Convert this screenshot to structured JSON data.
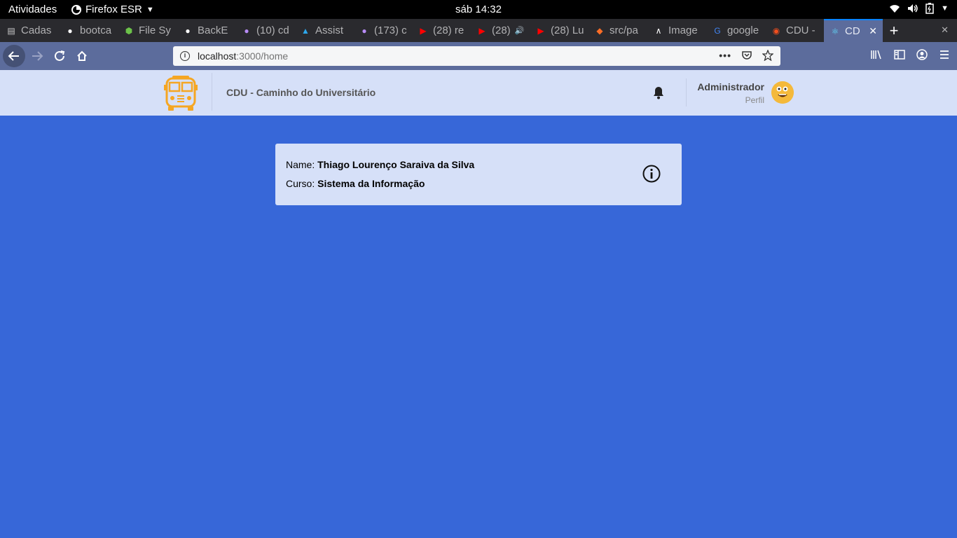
{
  "system_bar": {
    "activities": "Atividades",
    "app_menu": "Firefox ESR",
    "clock": "sáb 14:32"
  },
  "tabs": [
    {
      "label": "Cadas",
      "icon": "document-icon",
      "color": "#cccccc"
    },
    {
      "label": "bootca",
      "icon": "github-icon",
      "color": "#ffffff"
    },
    {
      "label": "File Sy",
      "icon": "nodejs-icon",
      "color": "#6cc24a"
    },
    {
      "label": "BackE",
      "icon": "github-icon",
      "color": "#ffffff"
    },
    {
      "label": "(10) cd",
      "icon": "notification-icon",
      "color": "#b88cf7"
    },
    {
      "label": "Assist",
      "icon": "wave-icon",
      "color": "#2da7ec"
    },
    {
      "label": "(173) c",
      "icon": "notification-icon",
      "color": "#b88cf7"
    },
    {
      "label": "(28) re",
      "icon": "youtube-icon",
      "color": "#ff0000"
    },
    {
      "label": "(28)",
      "icon": "youtube-icon",
      "color": "#ff0000",
      "muted": true
    },
    {
      "label": "(28) Lu",
      "icon": "youtube-icon",
      "color": "#ff0000"
    },
    {
      "label": "src/pa",
      "icon": "gitlab-icon",
      "color": "#fc6d26"
    },
    {
      "label": "Image",
      "icon": "caret-logo-icon",
      "color": "#ffffff"
    },
    {
      "label": "google",
      "icon": "google-icon",
      "color": "#4285f4"
    },
    {
      "label": "CDU -",
      "icon": "figma-icon",
      "color": "#f24e1e"
    },
    {
      "label": "CD",
      "icon": "react-icon",
      "color": "#61dafb",
      "active": true
    }
  ],
  "nav": {
    "url_host": "localhost",
    "url_path": ":3000/home"
  },
  "app_header": {
    "title": "CDU - Caminho do Universitário",
    "user_name": "Administrador",
    "user_role": "Perfil"
  },
  "card": {
    "name_label": "Name:",
    "name_value": "Thiago Lourenço Saraiva da Silva",
    "course_label": "Curso:",
    "course_value": "Sistema da Informação"
  },
  "colors": {
    "page_bg": "#3767d8",
    "header_bg": "#d6e0f8",
    "bus_yellow": "#f5a623"
  }
}
